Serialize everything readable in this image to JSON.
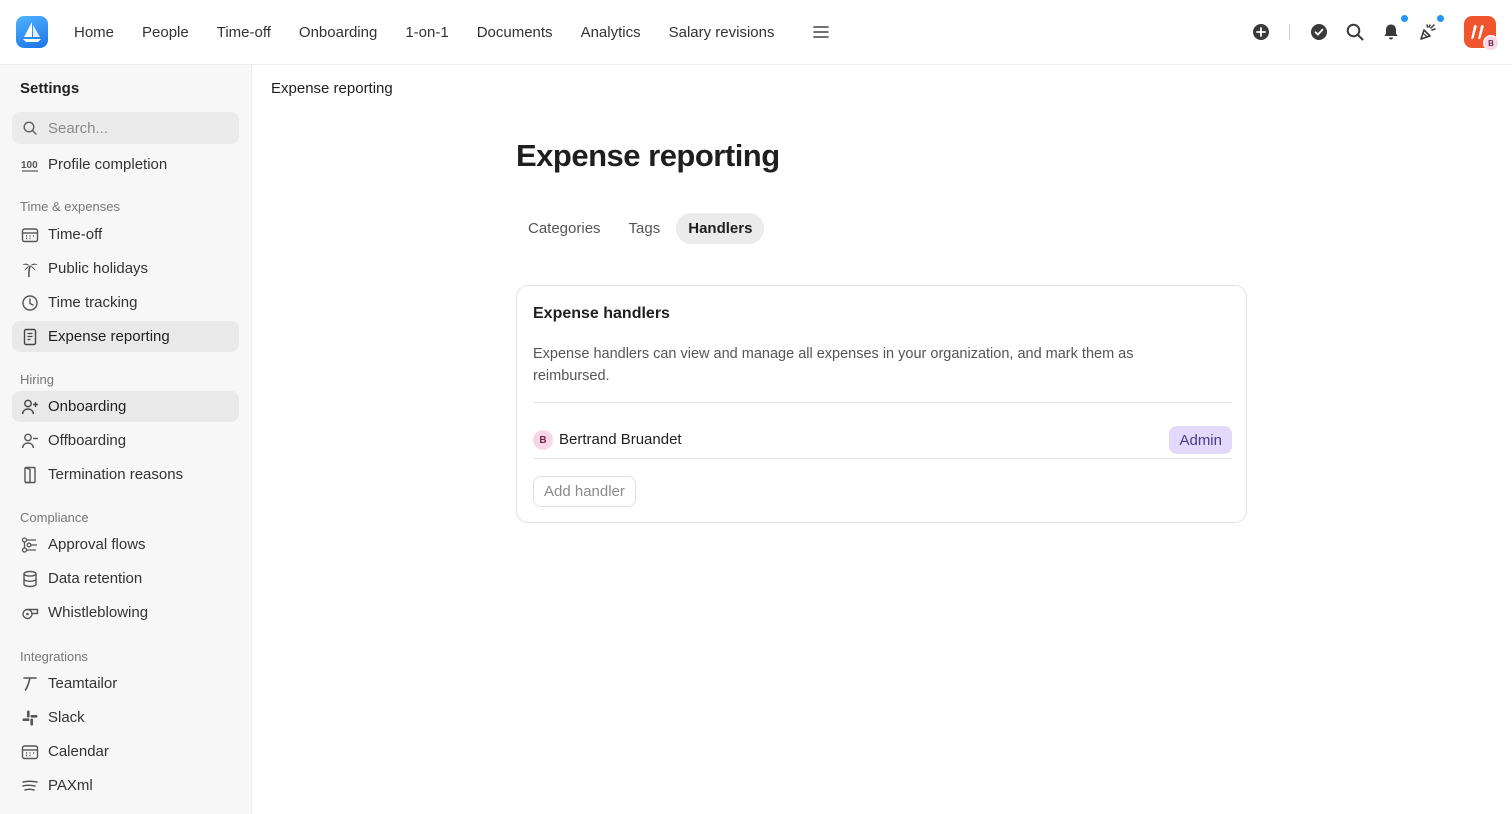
{
  "nav": {
    "items": [
      "Home",
      "People",
      "Time-off",
      "Onboarding",
      "1-on-1",
      "Documents",
      "Analytics",
      "Salary revisions"
    ],
    "menu_icon": "hamburger-icon"
  },
  "top_icons": [
    "plus-circle-icon",
    "check-circle-icon",
    "search-icon",
    "bell-icon",
    "party-popper-icon"
  ],
  "user": {
    "initial": "B"
  },
  "sidebar": {
    "title": "Settings",
    "search_placeholder": "Search...",
    "profile_completion": "Profile completion",
    "sections": {
      "time_expenses": "Time & expenses",
      "hiring": "Hiring",
      "compliance": "Compliance",
      "integrations": "Integrations"
    },
    "items": {
      "time_off": "Time-off",
      "public_holidays": "Public holidays",
      "time_tracking": "Time tracking",
      "expense_reporting": "Expense reporting",
      "onboarding": "Onboarding",
      "offboarding": "Offboarding",
      "termination_reasons": "Termination reasons",
      "approval_flows": "Approval flows",
      "data_retention": "Data retention",
      "whistleblowing": "Whistleblowing",
      "teamtailor": "Teamtailor",
      "slack": "Slack",
      "calendar": "Calendar",
      "paxml": "PAXml"
    }
  },
  "main": {
    "breadcrumb": "Expense reporting",
    "title": "Expense reporting",
    "tabs": [
      "Categories",
      "Tags",
      "Handlers"
    ],
    "active_tab": "Handlers",
    "card": {
      "title": "Expense handlers",
      "description": "Expense handlers can view and manage all expenses in your organization, and mark them as reimbursed.",
      "handlers": [
        {
          "initial": "B",
          "name": "Bertrand Bruandet",
          "role": "Admin"
        }
      ],
      "add_button": "Add handler"
    }
  },
  "colors": {
    "accent_dot": "#2196f3",
    "badge_bg": "#e2d9fb",
    "logo": "#1a73e8",
    "app_avatar": "#f0552e"
  }
}
